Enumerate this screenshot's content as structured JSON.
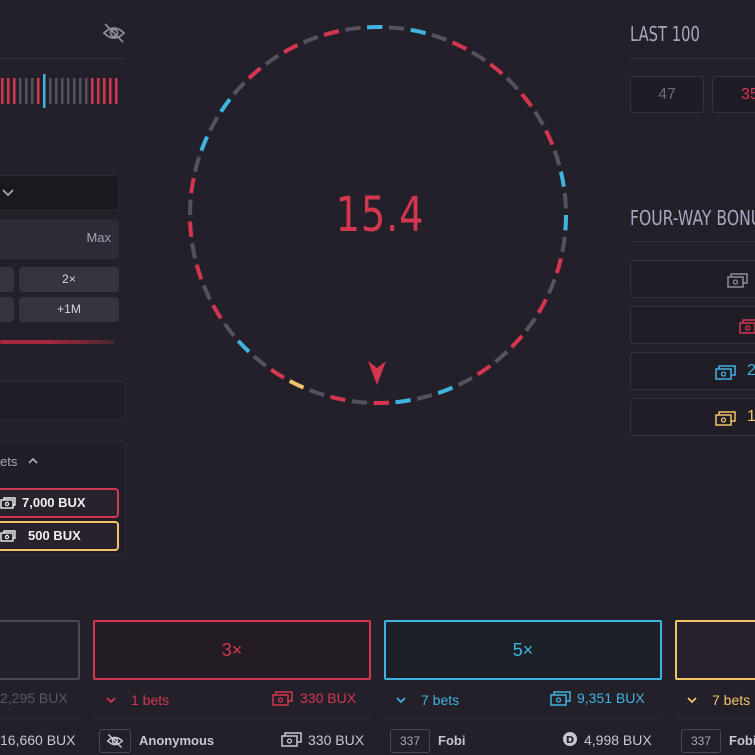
{
  "left_panel": {
    "max_label": "Max",
    "quick_buttons": [
      {
        "label": "2×"
      },
      {
        "label": "+1M"
      }
    ],
    "bets_toggle_label": "ets",
    "bet_pills": [
      {
        "label": "7,000 BUX",
        "color": "#d43650"
      },
      {
        "label": "500 BUX",
        "color": "#f2c468"
      }
    ]
  },
  "wheel": {
    "timer_value": "15.4",
    "segment_colors": {
      "red": "#d43650",
      "gray": "#55525c",
      "blue": "#3fb4e0",
      "gold": "#f2c468"
    }
  },
  "right_panel": {
    "last100_title": "LAST 100",
    "last100_values": [
      {
        "value": "47",
        "color": "#6f6b78"
      },
      {
        "value": "35",
        "color": "#d43650"
      }
    ],
    "fourway_title": "FOUR-WAY BONU",
    "fourway_rows": [
      {
        "icon": "money-icon",
        "color": "#8f8b98",
        "value": ""
      },
      {
        "icon": "money-icon",
        "color": "#d43650",
        "value": ""
      },
      {
        "icon": "money-icon",
        "color": "#3fb4e0",
        "value": "2"
      },
      {
        "icon": "money-icon",
        "color": "#f2c468",
        "value": "1"
      }
    ]
  },
  "columns": [
    {
      "id": "gray",
      "multiplier": "",
      "total": "2,295 BUX",
      "entry_amount": "16,660 BUX",
      "color": "#6f6b78"
    },
    {
      "id": "red",
      "multiplier": "3×",
      "bets_count": "1 bets",
      "total": "330 BUX",
      "entry_name": "Anonymous",
      "entry_amount": "330 BUX",
      "color": "#d43650"
    },
    {
      "id": "blue",
      "multiplier": "5×",
      "bets_count": "7 bets",
      "total": "9,351 BUX",
      "entry_level": "337",
      "entry_name": "Fobi",
      "entry_amount": "4,998 BUX",
      "color": "#3fb4e0"
    },
    {
      "id": "gold",
      "multiplier": "",
      "bets_count": "7 bets",
      "entry_level": "337",
      "entry_name": "Fobi",
      "color": "#f2c468"
    }
  ]
}
